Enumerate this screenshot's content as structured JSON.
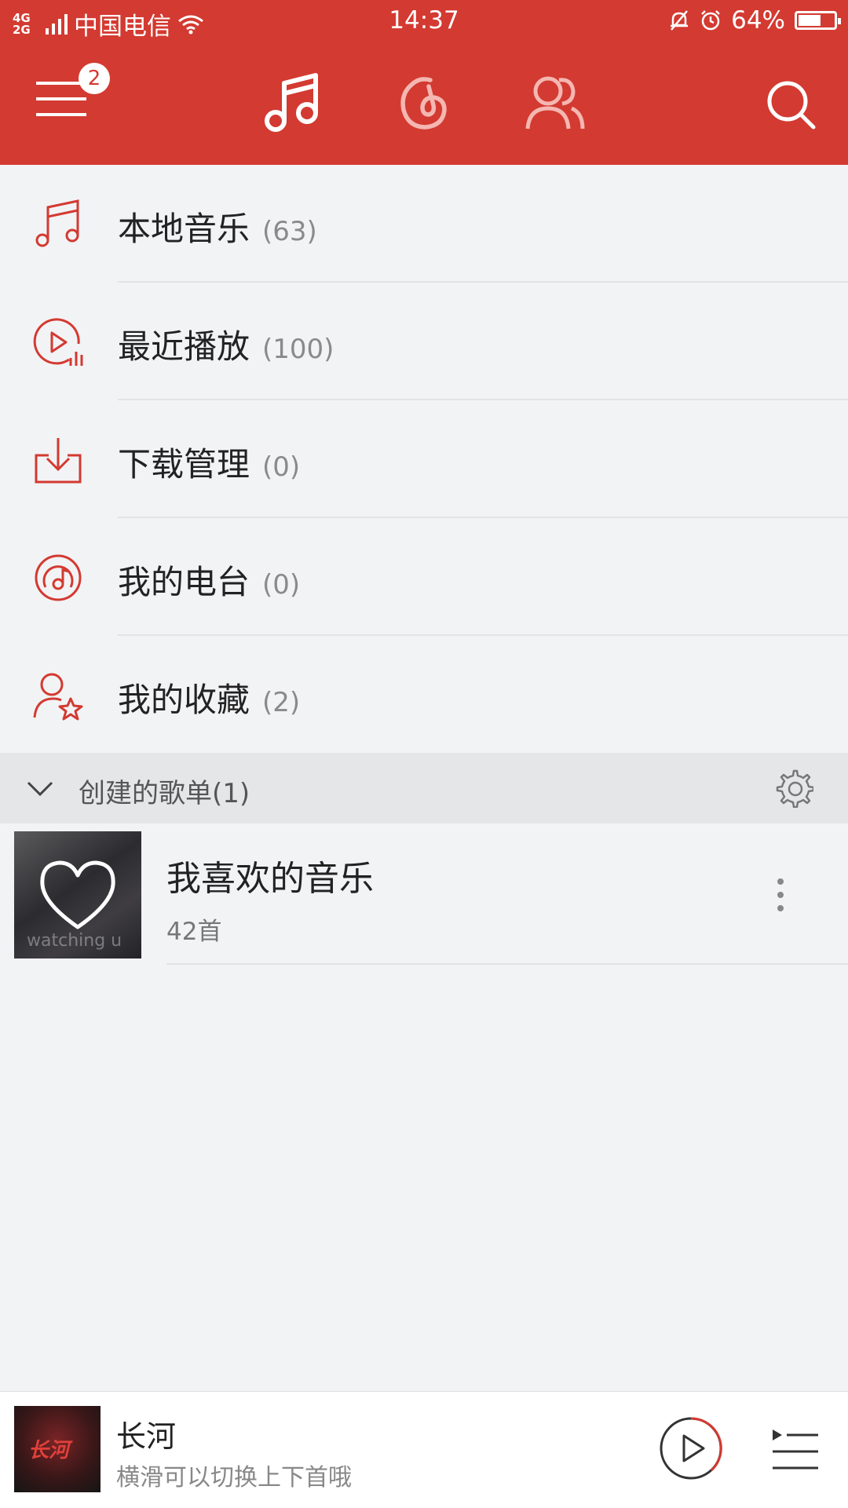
{
  "status_bar": {
    "network": "4G 2G",
    "carrier": "中国电信",
    "time": "14:37",
    "battery": "64%",
    "battery_level": 0.64
  },
  "nav": {
    "notification_count": "2",
    "tabs": [
      {
        "icon": "music-note-icon",
        "active": true
      },
      {
        "icon": "netease-logo-icon",
        "active": false
      },
      {
        "icon": "friends-icon",
        "active": false
      }
    ]
  },
  "menu": {
    "items": [
      {
        "label": "本地音乐",
        "count": "(63)",
        "icon": "local-music-icon"
      },
      {
        "label": "最近播放",
        "count": "(100)",
        "icon": "recent-play-icon"
      },
      {
        "label": "下载管理",
        "count": "(0)",
        "icon": "download-icon"
      },
      {
        "label": "我的电台",
        "count": "(0)",
        "icon": "radio-icon"
      },
      {
        "label": "我的收藏",
        "count": "(2)",
        "icon": "favorites-icon"
      }
    ]
  },
  "playlists_section": {
    "title": "创建的歌单(1)",
    "playlists": [
      {
        "name": "我喜欢的音乐",
        "count": "42首",
        "cover_watermark": "watching u"
      }
    ]
  },
  "player": {
    "song": "长河",
    "hint": "横滑可以切换上下首哦",
    "art_text": "长河"
  },
  "colors": {
    "brand_red": "#d33a31",
    "background": "#f2f3f5"
  }
}
